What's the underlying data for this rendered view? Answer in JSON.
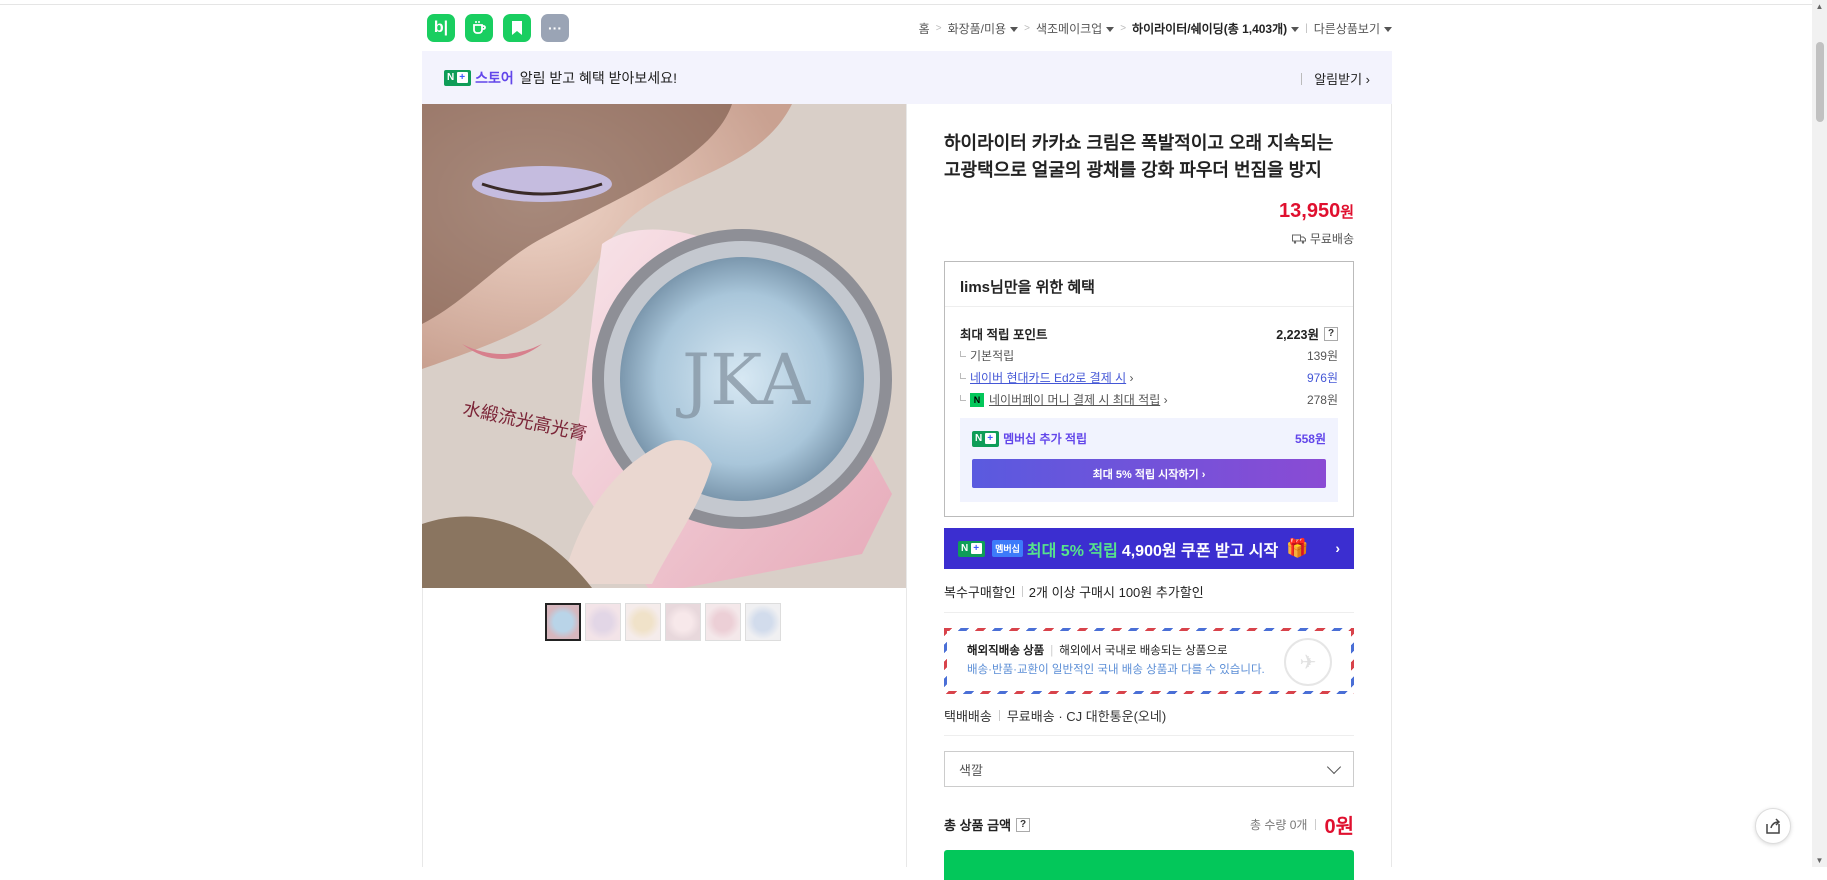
{
  "apps": {
    "blog": {
      "label": "b|",
      "color": "#19ce60"
    },
    "cafe": {
      "label": "☕",
      "color": "#19ce60"
    },
    "bookmark": {
      "label": "",
      "color": "#19ce60"
    },
    "more": {
      "label": "···",
      "color": "#9aa4b5"
    }
  },
  "breadcrumb": {
    "home": "홈",
    "c1": "화장품/미용",
    "c2": "색조메이크업",
    "c3": "하이라이터/쉐이딩(총 1,403개)",
    "other": "다른상품보기"
  },
  "banner": {
    "badge": "N",
    "store": "스토어",
    "text": "알림 받고 혜택 받아보세요!",
    "alert": "알림받기 ›"
  },
  "product": {
    "title": "하이라이터 카카쇼 크림은 폭발적이고 오래 지속되는 고광택으로 얼굴의 광채를 강화 파우더 번짐을 방지",
    "price_num": "13,950",
    "price_unit": "원",
    "shipping": "무료배송"
  },
  "benefit": {
    "heading": "lims님만을 위한 혜택",
    "max_label": "최대 적립 포인트",
    "max_value": "2,223원",
    "basic_label": "기본적립",
    "basic_value": "139원",
    "card_label": "네이버 현대카드 Ed2로 결제 시",
    "card_value": "976원",
    "pay_label": "네이버페이 머니 결제 시 최대 적립",
    "pay_value": "278원",
    "member_label": "멤버십 추가 적립",
    "member_value": "558원",
    "member_btn": "최대 5% 적립 시작하기 ›"
  },
  "coupon": {
    "mem": "멤버십",
    "text1": "최대 5% 적립",
    "text2": "4,900원 쿠폰 받고 시작",
    "chev": "›"
  },
  "multi": {
    "label": "복수구매할인",
    "text": "2개 이상 구매시 100원 추가할인"
  },
  "intl": {
    "label": "해외직배송 상품",
    "text": "해외에서 국내로 배송되는 상품으로",
    "note": "배송·반품·교환이 일반적인 국내 배송 상품과 다를 수 있습니다."
  },
  "delivery": {
    "type": "택배배송",
    "fee": "무료배송",
    "carrier": "· CJ 대한통운(오네)"
  },
  "option": {
    "placeholder": "색깔"
  },
  "total": {
    "label": "총 상품 금액",
    "qty": "총 수량 0개",
    "amount": "0원"
  },
  "colors": {
    "brand_green": "#03c75a",
    "price_red": "#e0102f",
    "accent_purple": "#6246ea"
  }
}
